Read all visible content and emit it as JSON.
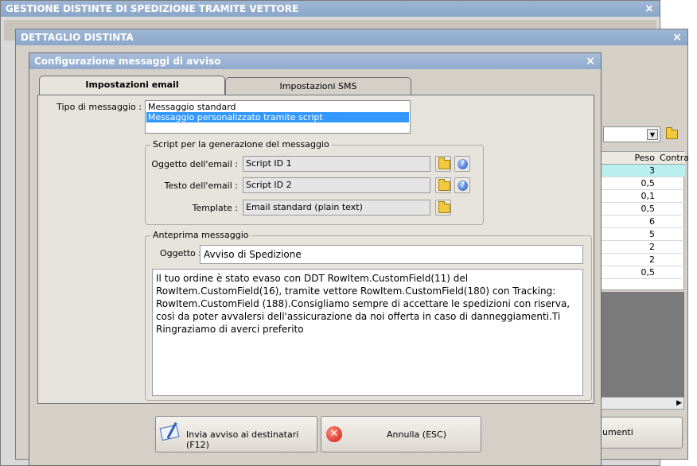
{
  "bg_window": {
    "title": "GESTIONE DISTINTE DI SPEDIZIONE TRAMITE VETTORE",
    "close": "×"
  },
  "mid_window": {
    "title": "DETTAGLIO DISTINTA",
    "close": "×",
    "header_col_peso": "Peso",
    "header_col_contr": "Contra",
    "peso_values": [
      "3",
      "0,5",
      "0,1",
      "0,5",
      "6",
      "5",
      "2",
      "2",
      "0,5"
    ],
    "bottom_button_partial": "umenti"
  },
  "dialog": {
    "title": "Configurazione messaggi di avviso",
    "close": "×",
    "tabs": [
      {
        "label": "Impostazioni email"
      },
      {
        "label": "Impostazioni SMS"
      }
    ],
    "message_type": {
      "label": "Tipo di messaggio :",
      "options": [
        "Messaggio standard",
        "Messaggio personalizzato tramite script"
      ],
      "selected": "Messaggio personalizzato tramite script"
    },
    "script_group": {
      "title": "Script per la generazione del messaggio",
      "subject_label": "Oggetto dell'email :",
      "subject_value": "Script ID 1",
      "body_label": "Testo dell'email :",
      "body_value": "Script ID 2",
      "template_label": "Template :",
      "template_value": "Email standard (plain text)"
    },
    "preview_group": {
      "title": "Anteprima messaggio",
      "subject_label": "Oggetto :",
      "subject_value": "Avviso di Spedizione",
      "body_text": "Il tuo ordine è stato evaso con DDT RowItem.CustomField(11) del RowItem.CustomField(16), tramite vettore RowItem.CustomField(180) con Tracking: RowItem.CustomField (188).Consigliamo sempre di accettare le spedizioni con riserva, così da poter avvalersi dell'assicurazione da noi offerta in caso di danneggiamenti.Ti Ringraziamo di averci preferito"
    },
    "buttons": {
      "send": "Invia avviso ai destinatari (F12)",
      "cancel": "Annulla (ESC)"
    }
  },
  "colors": {
    "titlebar": "#8aa6c9",
    "selection": "#3399ff",
    "dialog_bg": "#d4d0c8"
  },
  "icons": [
    "folder-icon",
    "help-icon",
    "send-email-icon",
    "cancel-icon",
    "dropdown-arrow-icon"
  ]
}
